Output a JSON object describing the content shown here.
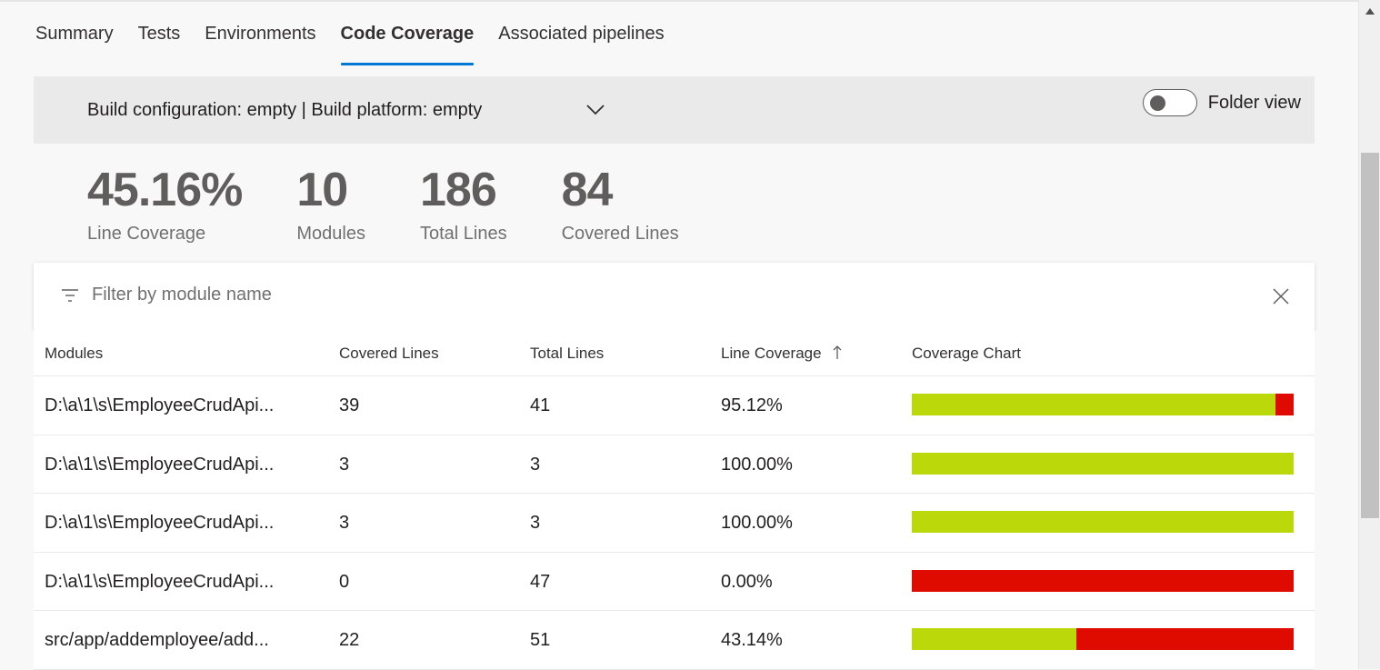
{
  "tabs": [
    {
      "label": "Summary"
    },
    {
      "label": "Tests"
    },
    {
      "label": "Environments"
    },
    {
      "label": "Code Coverage",
      "active": true
    },
    {
      "label": "Associated pipelines"
    }
  ],
  "config": {
    "label": "Build configuration: empty | Build platform: empty",
    "toggle_label": "Folder view",
    "toggle_on": false
  },
  "stats": [
    {
      "value": "45.16%",
      "label": "Line Coverage"
    },
    {
      "value": "10",
      "label": "Modules"
    },
    {
      "value": "186",
      "label": "Total Lines"
    },
    {
      "value": "84",
      "label": "Covered Lines"
    }
  ],
  "filter": {
    "placeholder": "Filter by module name",
    "value": ""
  },
  "table": {
    "headers": [
      "Modules",
      "Covered Lines",
      "Total Lines",
      "Line Coverage",
      "Coverage Chart"
    ],
    "rows": [
      {
        "module": "D:\\a\\1\\s\\EmployeeCrudApi...",
        "covered": "39",
        "total": "41",
        "coverage": "95.12%",
        "coverage_fraction": 0.9512
      },
      {
        "module": "D:\\a\\1\\s\\EmployeeCrudApi...",
        "covered": "3",
        "total": "3",
        "coverage": "100.00%",
        "coverage_fraction": 1.0
      },
      {
        "module": "D:\\a\\1\\s\\EmployeeCrudApi...",
        "covered": "3",
        "total": "3",
        "coverage": "100.00%",
        "coverage_fraction": 1.0
      },
      {
        "module": "D:\\a\\1\\s\\EmployeeCrudApi...",
        "covered": "0",
        "total": "47",
        "coverage": "0.00%",
        "coverage_fraction": 0.0
      },
      {
        "module": "src/app/addemployee/add...",
        "covered": "22",
        "total": "51",
        "coverage": "43.14%",
        "coverage_fraction": 0.4314
      }
    ]
  },
  "colors": {
    "accent": "#0078d4",
    "covered": "#bad80a",
    "uncovered": "#e00b00"
  },
  "icons": {
    "dropdown": "chevron-down-icon",
    "filter": "filter-icon",
    "clear": "close-icon",
    "sort": "sort-ascending-icon"
  }
}
